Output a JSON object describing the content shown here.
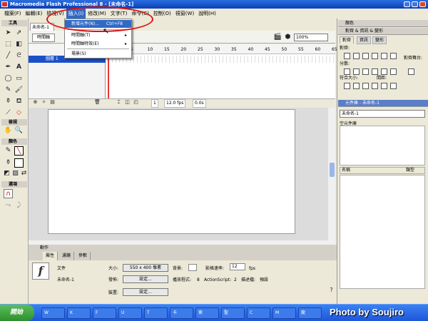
{
  "window": {
    "title": "Macromedia Flash Professional 8 - [未命名-1]"
  },
  "menubar": [
    "檔案(F)",
    "編輯(E)",
    "檢視(V)",
    "插入(I)",
    "修改(M)",
    "文字(T)",
    "命令(C)",
    "控制(O)",
    "視窗(W)",
    "說明(H)"
  ],
  "insert_menu": [
    {
      "label": "新增元件(N)...",
      "shortcut": "Ctrl+F8",
      "highlighted": true
    },
    {
      "label": "時間軸(T)",
      "submenu": true
    },
    {
      "label": "時間軸特效(E)",
      "submenu": true
    },
    {
      "label": "場景(S)"
    }
  ],
  "tools": {
    "section_tools": "工具",
    "section_view": "檢視",
    "section_colors": "顏色",
    "section_options": "選項"
  },
  "document": {
    "tab": "未命名-1",
    "timeline_button": "時間軸",
    "zoom": "100%",
    "layer_name": "圖層 1"
  },
  "timeline": {
    "frame_numbers": [
      "5",
      "10",
      "15",
      "20",
      "25",
      "30",
      "35",
      "40",
      "45",
      "50",
      "55",
      "60",
      "65"
    ],
    "current_frame": "1",
    "fps": "12.0 fps",
    "time": "0.0s"
  },
  "actions_bar": "動作",
  "properties": {
    "tabs": [
      "屬性",
      "濾鏡",
      "參數"
    ],
    "doc_label": "文件",
    "doc_name": "未命名-1",
    "size_label": "大小:",
    "size_value": "550 x 400 像素",
    "bg_label": "背景:",
    "rate_label": "影格速率:",
    "rate_value": "12",
    "rate_unit": "fps",
    "publish_label": "發佈:",
    "publish_btn": "設定...",
    "player_label": "播放程式:",
    "player_value": "8",
    "as_label": "ActionScript:",
    "as_value": "2",
    "desc_label": "描述檔:",
    "desc_value": "預設",
    "devices_label": "裝置:",
    "devices_btn": "設定..."
  },
  "right_panel": {
    "color_header": "顏色",
    "align_header": "對齊 & 資訊 & 變形",
    "tabs": [
      "對齊",
      "資訊",
      "變形"
    ],
    "align_label": "對齊:",
    "distribute_label": "分散:",
    "match_label": "符合大小:",
    "space_label": "間距:",
    "stage_label": "對齊舞台:",
    "library_header": "元件庫 - 未命名-1",
    "library_select": "未命名-1",
    "library_empty": "空元件庫",
    "col_name": "名稱",
    "col_type": "類型"
  },
  "taskbar": {
    "start": "開始",
    "buttons": [
      "W",
      "K",
      "F",
      "U",
      "T",
      "卡",
      "索",
      "聖",
      "C",
      "M",
      "龍"
    ]
  },
  "watermark": "Photo by Soujiro"
}
